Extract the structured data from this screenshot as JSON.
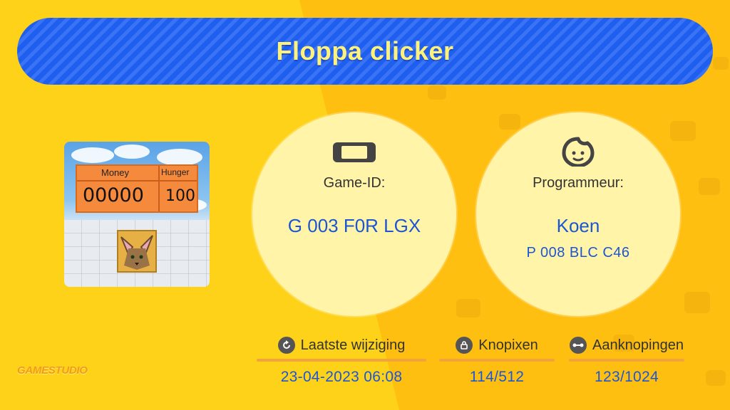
{
  "title": "Floppa clicker",
  "thumbnail": {
    "money_label": "Money",
    "hunger_label": "Hunger",
    "money_value": "00000",
    "hunger_value": "100"
  },
  "game_id": {
    "icon": "game-console-icon",
    "label": "Game-ID:",
    "value": "G 003 F0R LGX"
  },
  "programmer": {
    "icon": "face-icon",
    "label": "Programmeur:",
    "name": "Koen",
    "id": "P 008 BLC C46"
  },
  "info": [
    {
      "icon": "refresh-icon",
      "label": "Laatste wijziging",
      "value": "23-04-2023 06:08"
    },
    {
      "icon": "lock-icon",
      "label": "Knopixen",
      "value": "114/512"
    },
    {
      "icon": "link-icon",
      "label": "Aanknopingen",
      "value": "123/1024"
    }
  ],
  "studio_logo": "GAMESTUDIO",
  "colors": {
    "background": "#ffd21a",
    "title_bar": "#1f5ff0",
    "title_text": "#fff27a",
    "circle": "#fff4a8",
    "value_text": "#1c56d4",
    "divider": "#f2a33a"
  }
}
